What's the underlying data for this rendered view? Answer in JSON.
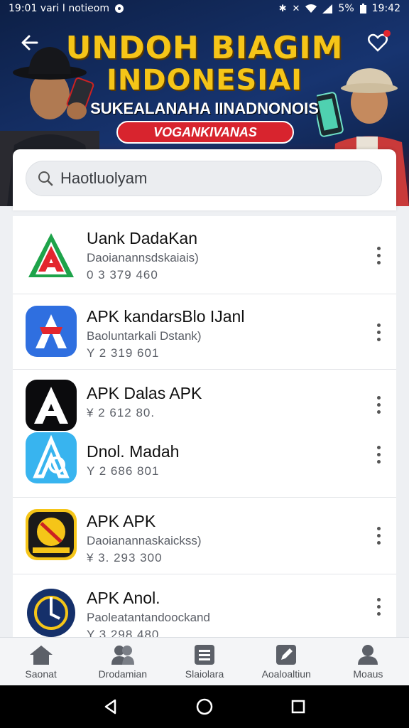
{
  "status_bar": {
    "time_left": "19:01 vari I notieom",
    "battery": "5%",
    "time_right": "19:42"
  },
  "banner": {
    "title_line1": "UNDOH BIAGIM",
    "title_line2": "INDONESIAI",
    "subtitle": "SUKEALANAHA IINADNONOIS",
    "pill": "VOGANKIVANAS",
    "accent_color": "#f5c518",
    "pill_color": "#d8242e"
  },
  "search": {
    "value": "Haotluolyam"
  },
  "apps": [
    {
      "name": "Uank DadaKan",
      "desc": "Daoianannsdskaiais)",
      "meta": "0 3  379  460",
      "icon": "green-red-a-logo"
    },
    {
      "name": "APK kandarsBlo IJanl",
      "desc": "Baoluntarkali Dstank)",
      "meta": "Y 2  319  601",
      "icon": "blue-a-logo"
    },
    {
      "name": "APK Dalas APK",
      "desc": "",
      "meta": "¥ 2  612  80.",
      "icon": "black-a-logo"
    },
    {
      "name": "Dnol. Madah",
      "desc": "",
      "meta": "Y 2  686  801",
      "icon": "lightblue-a-logo"
    },
    {
      "name": "APK APK",
      "desc": "Daoianannaskaickss)",
      "meta": "¥ 3. 293  300",
      "icon": "yellow-badge-logo"
    },
    {
      "name": "APK Anol.",
      "desc": "Paoleatantandoockand",
      "meta": "Y 3  298  480",
      "icon": "navy-circle-logo"
    }
  ],
  "bottom_nav": [
    {
      "label": "Saonat",
      "icon": "home-icon"
    },
    {
      "label": "Drodamian",
      "icon": "people-icon"
    },
    {
      "label": "Slaiolara",
      "icon": "list-icon"
    },
    {
      "label": "Aoaloaltiun",
      "icon": "edit-icon"
    },
    {
      "label": "Moaus",
      "icon": "profile-icon"
    }
  ]
}
